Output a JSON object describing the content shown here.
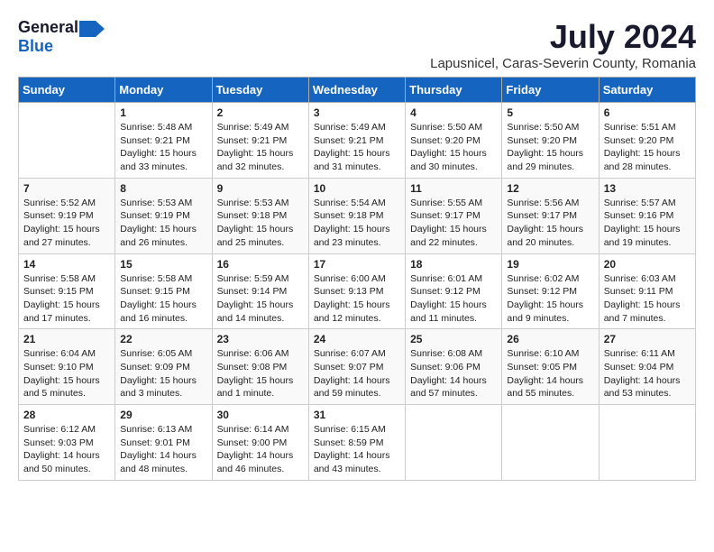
{
  "logo": {
    "general": "General",
    "blue": "Blue"
  },
  "title": "July 2024",
  "subtitle": "Lapusnicel, Caras-Severin County, Romania",
  "weekdays": [
    "Sunday",
    "Monday",
    "Tuesday",
    "Wednesday",
    "Thursday",
    "Friday",
    "Saturday"
  ],
  "weeks": [
    [
      {
        "day": "",
        "info": ""
      },
      {
        "day": "1",
        "info": "Sunrise: 5:48 AM\nSunset: 9:21 PM\nDaylight: 15 hours\nand 33 minutes."
      },
      {
        "day": "2",
        "info": "Sunrise: 5:49 AM\nSunset: 9:21 PM\nDaylight: 15 hours\nand 32 minutes."
      },
      {
        "day": "3",
        "info": "Sunrise: 5:49 AM\nSunset: 9:21 PM\nDaylight: 15 hours\nand 31 minutes."
      },
      {
        "day": "4",
        "info": "Sunrise: 5:50 AM\nSunset: 9:20 PM\nDaylight: 15 hours\nand 30 minutes."
      },
      {
        "day": "5",
        "info": "Sunrise: 5:50 AM\nSunset: 9:20 PM\nDaylight: 15 hours\nand 29 minutes."
      },
      {
        "day": "6",
        "info": "Sunrise: 5:51 AM\nSunset: 9:20 PM\nDaylight: 15 hours\nand 28 minutes."
      }
    ],
    [
      {
        "day": "7",
        "info": "Sunrise: 5:52 AM\nSunset: 9:19 PM\nDaylight: 15 hours\nand 27 minutes."
      },
      {
        "day": "8",
        "info": "Sunrise: 5:53 AM\nSunset: 9:19 PM\nDaylight: 15 hours\nand 26 minutes."
      },
      {
        "day": "9",
        "info": "Sunrise: 5:53 AM\nSunset: 9:18 PM\nDaylight: 15 hours\nand 25 minutes."
      },
      {
        "day": "10",
        "info": "Sunrise: 5:54 AM\nSunset: 9:18 PM\nDaylight: 15 hours\nand 23 minutes."
      },
      {
        "day": "11",
        "info": "Sunrise: 5:55 AM\nSunset: 9:17 PM\nDaylight: 15 hours\nand 22 minutes."
      },
      {
        "day": "12",
        "info": "Sunrise: 5:56 AM\nSunset: 9:17 PM\nDaylight: 15 hours\nand 20 minutes."
      },
      {
        "day": "13",
        "info": "Sunrise: 5:57 AM\nSunset: 9:16 PM\nDaylight: 15 hours\nand 19 minutes."
      }
    ],
    [
      {
        "day": "14",
        "info": "Sunrise: 5:58 AM\nSunset: 9:15 PM\nDaylight: 15 hours\nand 17 minutes."
      },
      {
        "day": "15",
        "info": "Sunrise: 5:58 AM\nSunset: 9:15 PM\nDaylight: 15 hours\nand 16 minutes."
      },
      {
        "day": "16",
        "info": "Sunrise: 5:59 AM\nSunset: 9:14 PM\nDaylight: 15 hours\nand 14 minutes."
      },
      {
        "day": "17",
        "info": "Sunrise: 6:00 AM\nSunset: 9:13 PM\nDaylight: 15 hours\nand 12 minutes."
      },
      {
        "day": "18",
        "info": "Sunrise: 6:01 AM\nSunset: 9:12 PM\nDaylight: 15 hours\nand 11 minutes."
      },
      {
        "day": "19",
        "info": "Sunrise: 6:02 AM\nSunset: 9:12 PM\nDaylight: 15 hours\nand 9 minutes."
      },
      {
        "day": "20",
        "info": "Sunrise: 6:03 AM\nSunset: 9:11 PM\nDaylight: 15 hours\nand 7 minutes."
      }
    ],
    [
      {
        "day": "21",
        "info": "Sunrise: 6:04 AM\nSunset: 9:10 PM\nDaylight: 15 hours\nand 5 minutes."
      },
      {
        "day": "22",
        "info": "Sunrise: 6:05 AM\nSunset: 9:09 PM\nDaylight: 15 hours\nand 3 minutes."
      },
      {
        "day": "23",
        "info": "Sunrise: 6:06 AM\nSunset: 9:08 PM\nDaylight: 15 hours\nand 1 minute."
      },
      {
        "day": "24",
        "info": "Sunrise: 6:07 AM\nSunset: 9:07 PM\nDaylight: 14 hours\nand 59 minutes."
      },
      {
        "day": "25",
        "info": "Sunrise: 6:08 AM\nSunset: 9:06 PM\nDaylight: 14 hours\nand 57 minutes."
      },
      {
        "day": "26",
        "info": "Sunrise: 6:10 AM\nSunset: 9:05 PM\nDaylight: 14 hours\nand 55 minutes."
      },
      {
        "day": "27",
        "info": "Sunrise: 6:11 AM\nSunset: 9:04 PM\nDaylight: 14 hours\nand 53 minutes."
      }
    ],
    [
      {
        "day": "28",
        "info": "Sunrise: 6:12 AM\nSunset: 9:03 PM\nDaylight: 14 hours\nand 50 minutes."
      },
      {
        "day": "29",
        "info": "Sunrise: 6:13 AM\nSunset: 9:01 PM\nDaylight: 14 hours\nand 48 minutes."
      },
      {
        "day": "30",
        "info": "Sunrise: 6:14 AM\nSunset: 9:00 PM\nDaylight: 14 hours\nand 46 minutes."
      },
      {
        "day": "31",
        "info": "Sunrise: 6:15 AM\nSunset: 8:59 PM\nDaylight: 14 hours\nand 43 minutes."
      },
      {
        "day": "",
        "info": ""
      },
      {
        "day": "",
        "info": ""
      },
      {
        "day": "",
        "info": ""
      }
    ]
  ]
}
